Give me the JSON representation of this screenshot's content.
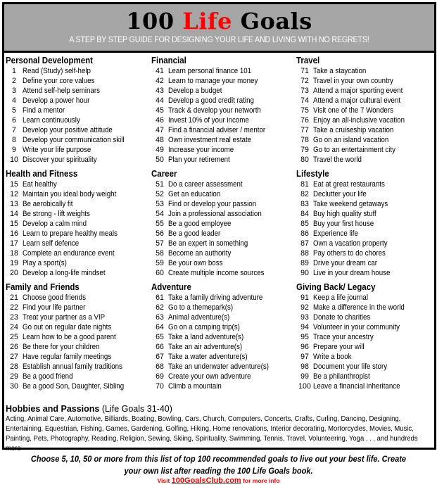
{
  "header": {
    "title_part1": "100 ",
    "title_part2": "Life",
    "title_part3": " Goals",
    "subtitle": "A STEP BY STEP GUIDE FOR DESIGNING YOUR LIFE AND LIVING WITH NO REGRETS!",
    "accent_color": "#ff0000",
    "band_color": "#a6a6a6"
  },
  "columns": [
    {
      "sections": [
        {
          "title": "Personal Development",
          "items": [
            {
              "num": "1",
              "text": "Read (Study) self-help"
            },
            {
              "num": "2",
              "text": "Define your core values"
            },
            {
              "num": "3",
              "text": "Attend self-help seminars"
            },
            {
              "num": "4",
              "text": "Develop a power hour"
            },
            {
              "num": "5",
              "text": "Find a mentor"
            },
            {
              "num": "6",
              "text": "Learn continuously"
            },
            {
              "num": "7",
              "text": "Develop your positive attitude"
            },
            {
              "num": "8",
              "text": "Develop your communication skill"
            },
            {
              "num": "9",
              "text": "Write your life purpose"
            },
            {
              "num": "10",
              "text": "Discover your spirituality"
            }
          ]
        },
        {
          "title": "Health and Fitness",
          "items": [
            {
              "num": "15",
              "text": "Eat healthy"
            },
            {
              "num": "12",
              "text": "Maintain you ideal body weight"
            },
            {
              "num": "13",
              "text": "Be aerobically fit"
            },
            {
              "num": "14",
              "text": "Be strong  - lift weights"
            },
            {
              "num": "15",
              "text": "Develop a calm mind"
            },
            {
              "num": "16",
              "text": "Learn to prepare healthy meals"
            },
            {
              "num": "17",
              "text": "Learn self defence"
            },
            {
              "num": "18",
              "text": "Complete an endurance event"
            },
            {
              "num": "19",
              "text": "Play a sport(s)"
            },
            {
              "num": "20",
              "text": "Develop a long-life mindset"
            }
          ]
        },
        {
          "title": "Family and Friends",
          "items": [
            {
              "num": "21",
              "text": "Choose good friends"
            },
            {
              "num": "22",
              "text": "Find your life partner"
            },
            {
              "num": "23",
              "text": "Treat your partner as a VIP"
            },
            {
              "num": "24",
              "text": "Go out on regular date nights"
            },
            {
              "num": "25",
              "text": "Learn how to be a good parent"
            },
            {
              "num": "26",
              "text": "Be there for your children"
            },
            {
              "num": "27",
              "text": "Have regular family meetings"
            },
            {
              "num": "28",
              "text": "Establish annual family traditions"
            },
            {
              "num": "29",
              "text": "Be a good friend"
            },
            {
              "num": "30",
              "text": "Be a good Son, Daughter, Sibling"
            }
          ]
        }
      ]
    },
    {
      "sections": [
        {
          "title": "Financial",
          "items": [
            {
              "num": "41",
              "text": "Learn personal finance 101"
            },
            {
              "num": "42",
              "text": "Learn to manage your money"
            },
            {
              "num": "43",
              "text": "Develop a budget"
            },
            {
              "num": "44",
              "text": "Develop a good credit rating"
            },
            {
              "num": "45",
              "text": "Track & develop your networth"
            },
            {
              "num": "46",
              "text": "Invest 10% of your income"
            },
            {
              "num": "47",
              "text": "Find a financial adviser / mentor"
            },
            {
              "num": "48",
              "text": "Own investment real estate"
            },
            {
              "num": "49",
              "text": "Increase your income"
            },
            {
              "num": "50",
              "text": "Plan your retirement"
            }
          ]
        },
        {
          "title": "Career",
          "items": [
            {
              "num": "51",
              "text": "Do a career assessment"
            },
            {
              "num": "52",
              "text": "Get an education"
            },
            {
              "num": "53",
              "text": "Find or develop your passion"
            },
            {
              "num": "54",
              "text": "Join a professional association"
            },
            {
              "num": "55",
              "text": "Be a good employee"
            },
            {
              "num": "56",
              "text": "Be a good leader"
            },
            {
              "num": "57",
              "text": "Be an expert in something"
            },
            {
              "num": "58",
              "text": "Become an authority"
            },
            {
              "num": "59",
              "text": "Be your own boss"
            },
            {
              "num": "60",
              "text": "Create multiple income sources"
            }
          ]
        },
        {
          "title": "Adventure",
          "items": [
            {
              "num": "61",
              "text": "Take a family driving adventure"
            },
            {
              "num": "62",
              "text": "Go to a themepark(s)"
            },
            {
              "num": "63",
              "text": "Animal adventure(s)"
            },
            {
              "num": "64",
              "text": "Go on a camping trip(s)"
            },
            {
              "num": "65",
              "text": "Take a land adventure(s)"
            },
            {
              "num": "66",
              "text": "Take an air adventure(s)"
            },
            {
              "num": "67",
              "text": "Take a water adventure(s)"
            },
            {
              "num": "68",
              "text": "Take an underwater adventure(s)"
            },
            {
              "num": "69",
              "text": "Create your own adventure"
            },
            {
              "num": "70",
              "text": "Climb a mountain"
            }
          ]
        }
      ]
    },
    {
      "sections": [
        {
          "title": "Travel",
          "items": [
            {
              "num": "71",
              "text": "Take a staycation"
            },
            {
              "num": "72",
              "text": "Travel in your own country"
            },
            {
              "num": "73",
              "text": "Attend a major sporting event"
            },
            {
              "num": "74",
              "text": "Attend a major cultural event"
            },
            {
              "num": "75",
              "text": "Visit one of the 7 Wonders"
            },
            {
              "num": "76",
              "text": "Enjoy an all-inclusive vacation"
            },
            {
              "num": "77",
              "text": "Take a cruiseship vacation"
            },
            {
              "num": "78",
              "text": "Go on an island vacation"
            },
            {
              "num": "79",
              "text": "Go to an entertainment city"
            },
            {
              "num": "80",
              "text": "Travel the world"
            }
          ]
        },
        {
          "title": "Lifestyle",
          "items": [
            {
              "num": "81",
              "text": "Eat at great restaurants"
            },
            {
              "num": "82",
              "text": "Declutter your life"
            },
            {
              "num": "83",
              "text": "Take weekend getaways"
            },
            {
              "num": "84",
              "text": "Buy high quality stuff"
            },
            {
              "num": "85",
              "text": "Buy your first house"
            },
            {
              "num": "86",
              "text": "Experience life"
            },
            {
              "num": "87",
              "text": "Own a vacation property"
            },
            {
              "num": "88",
              "text": "Pay others to do chores"
            },
            {
              "num": "89",
              "text": "Drive your dream car"
            },
            {
              "num": "90",
              "text": "Live in your dream house"
            }
          ]
        },
        {
          "title": "Giving Back/ Legacy",
          "items": [
            {
              "num": "91",
              "text": "Keep a life journal"
            },
            {
              "num": "92",
              "text": "Make a difference in the world"
            },
            {
              "num": "93",
              "text": "Donate to charities"
            },
            {
              "num": "94",
              "text": "Volunteer in your community"
            },
            {
              "num": "95",
              "text": "Trace your ancestry"
            },
            {
              "num": "96",
              "text": "Prepare your will"
            },
            {
              "num": "97",
              "text": "Write a book"
            },
            {
              "num": "98",
              "text": "Document your life story"
            },
            {
              "num": "99",
              "text": "Be a philanthropist"
            },
            {
              "num": "100",
              "text": "Leave a financial inheritance"
            }
          ]
        }
      ]
    }
  ],
  "hobbies": {
    "title": "Hobbies and Passions",
    "subtitle": " (Life Goals 31-40)",
    "text": "Acting, Animal Care, Automotive, Billiards, Boating, Bowling, Cars, Church, Computers, Concerts, Crafts, Curling, Dancing, Designing, Entertaining, Equestrian, Fishing, Games, Gardening, Golfing, Hiking, Home renovations, Interior decorating, Mortorcycles, Movies, Music, Painting, Pets, Photography, Reading, Religion, Sewing, Skiing, Spirituality, Swimming, Tennis, Travel, Volunteering, Yoga . . . and hundreds more"
  },
  "footer": {
    "line1": "Choose 5, 10, 50 or more from this list of top 100 recommended goals to live out your best life.   Create",
    "line2": "your own list after reading the 100 Life Goals book.",
    "visit_prefix": "Visit ",
    "visit_link": "100GoalsClub.com",
    "visit_suffix": " for more info"
  }
}
